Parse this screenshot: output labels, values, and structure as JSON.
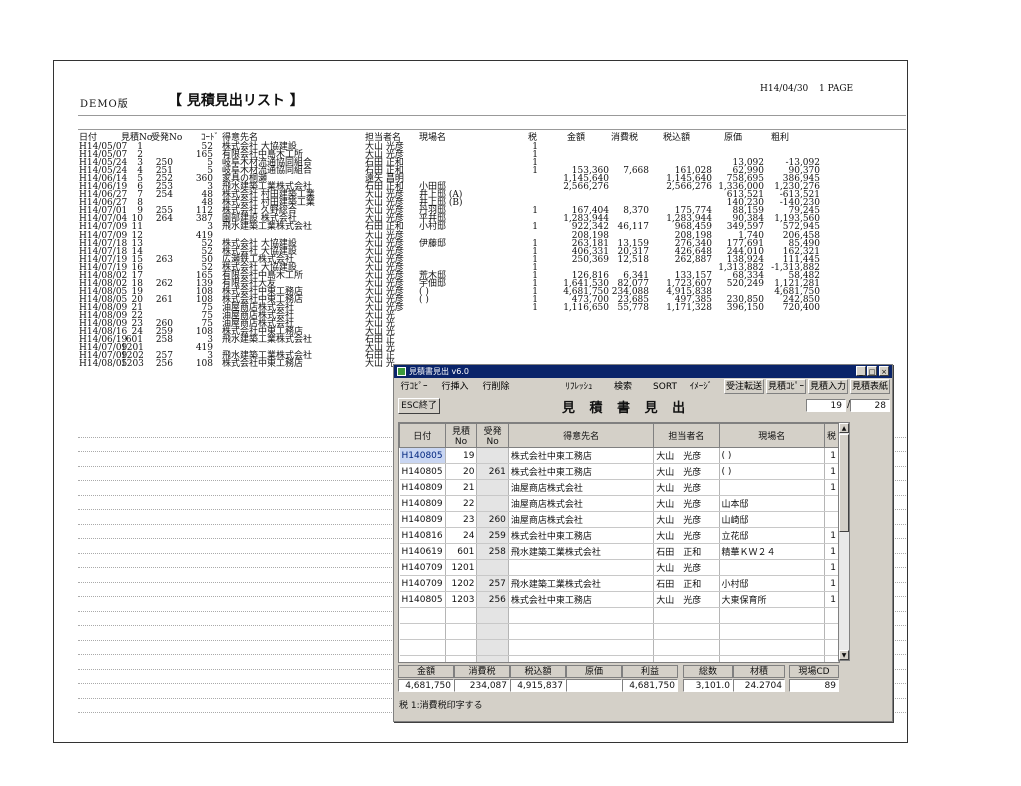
{
  "report": {
    "demo_label": "DEMO版",
    "title": "【 見積見出リスト 】",
    "date": "H14/04/30",
    "page": "1 PAGE",
    "headers": {
      "date": "日付",
      "mitsumori": "見積No",
      "juchu": "受発No",
      "code": "ｺｰﾄﾞ",
      "customer": "得意先名",
      "tanto": "担当者名",
      "genba": "現場名",
      "tax": "税",
      "amount": "金額",
      "shohizei": "消費税",
      "zeikomi": "税込額",
      "genka": "原価",
      "arari": "粗利"
    },
    "rows": [
      {
        "date": "H14/05/07",
        "no": "1",
        "juchu": "",
        "code": "52",
        "customer": "株式会社 大協建設",
        "tanto": "大山 光彦",
        "genba": "",
        "tax": "1",
        "amount": "",
        "shohizei": "",
        "zeikomi": "",
        "genka": "",
        "arari": ""
      },
      {
        "date": "H14/05/07",
        "no": "2",
        "juchu": "",
        "code": "165",
        "customer": "有限会社中島木工所",
        "tanto": "大山 光彦",
        "genba": "",
        "tax": "1",
        "amount": "",
        "shohizei": "",
        "zeikomi": "",
        "genka": "",
        "arari": ""
      },
      {
        "date": "H14/05/24",
        "no": "3",
        "juchu": "250",
        "code": "5",
        "customer": "岐阜木材流通協同組合",
        "tanto": "石田 正和",
        "genba": "",
        "tax": "1",
        "amount": "",
        "shohizei": "",
        "zeikomi": "",
        "genka": "13,092",
        "arari": "-13,092"
      },
      {
        "date": "H14/05/24",
        "no": "4",
        "juchu": "251",
        "code": "5",
        "customer": "岐阜木材流通協同組合",
        "tanto": "石田 正和",
        "genba": "",
        "tax": "1",
        "amount": "153,360",
        "shohizei": "7,668",
        "zeikomi": "161,028",
        "genka": "62,990",
        "arari": "90,370"
      },
      {
        "date": "H14/06/14",
        "no": "5",
        "juchu": "252",
        "code": "360",
        "customer": "家具の桐瀬",
        "tanto": "遠矢 昌明",
        "genba": "",
        "tax": "",
        "amount": "1,145,640",
        "shohizei": "",
        "zeikomi": "1,145,640",
        "genka": "758,695",
        "arari": "386,945"
      },
      {
        "date": "H14/06/19",
        "no": "6",
        "juchu": "253",
        "code": "3",
        "customer": "飛水建築工業株式会社",
        "tanto": "石田 正和",
        "genba": "小田邸",
        "tax": "",
        "amount": "2,566,276",
        "shohizei": "",
        "zeikomi": "2,566,276",
        "genka": "1,336,000",
        "arari": "1,230,276"
      },
      {
        "date": "H14/06/27",
        "no": "7",
        "juchu": "254",
        "code": "48",
        "customer": "株式会社 村田建築工業",
        "tanto": "大山 光彦",
        "genba": "井上邸 (A)",
        "tax": "",
        "amount": "",
        "shohizei": "",
        "zeikomi": "",
        "genka": "613,521",
        "arari": "-613,521"
      },
      {
        "date": "H14/06/27",
        "no": "8",
        "juchu": "",
        "code": "48",
        "customer": "株式会社 村田建築工業",
        "tanto": "大山 光彦",
        "genba": "井上邸 (B)",
        "tax": "",
        "amount": "",
        "shohizei": "",
        "zeikomi": "",
        "genka": "140,230",
        "arari": "-140,230"
      },
      {
        "date": "H14/07/01",
        "no": "9",
        "juchu": "255",
        "code": "112",
        "customer": "株式会社 久野総合",
        "tanto": "大山 光彦",
        "genba": "丹羽邸",
        "tax": "1",
        "amount": "167,404",
        "shohizei": "8,370",
        "zeikomi": "175,774",
        "genka": "88,159",
        "arari": "79,245"
      },
      {
        "date": "H14/07/04",
        "no": "10",
        "juchu": "264",
        "code": "387",
        "customer": "園部建設 株式会社",
        "tanto": "大山 光彦",
        "genba": "平井邸",
        "tax": "",
        "amount": "1,283,944",
        "shohizei": "",
        "zeikomi": "1,283,944",
        "genka": "90,384",
        "arari": "1,193,560"
      },
      {
        "date": "H14/07/09",
        "no": "11",
        "juchu": "",
        "code": "3",
        "customer": "飛水建築工業株式会社",
        "tanto": "石田 正和",
        "genba": "小村邸",
        "tax": "1",
        "amount": "922,342",
        "shohizei": "46,117",
        "zeikomi": "968,459",
        "genka": "349,597",
        "arari": "572,945"
      },
      {
        "date": "H14/07/09",
        "no": "12",
        "juchu": "",
        "code": "419",
        "customer": "",
        "tanto": "大山 光彦",
        "genba": "",
        "tax": "",
        "amount": "208,198",
        "shohizei": "",
        "zeikomi": "208,198",
        "genka": "1,740",
        "arari": "206,458"
      },
      {
        "date": "H14/07/18",
        "no": "13",
        "juchu": "",
        "code": "52",
        "customer": "株式会社 大協建設",
        "tanto": "大山 光彦",
        "genba": "伊藤邸",
        "tax": "1",
        "amount": "263,181",
        "shohizei": "13,159",
        "zeikomi": "276,340",
        "genka": "177,691",
        "arari": "85,490"
      },
      {
        "date": "H14/07/18",
        "no": "14",
        "juchu": "",
        "code": "52",
        "customer": "株式会社 大協建設",
        "tanto": "大山 光彦",
        "genba": "",
        "tax": "1",
        "amount": "406,331",
        "shohizei": "20,317",
        "zeikomi": "426,648",
        "genka": "244,010",
        "arari": "162,321"
      },
      {
        "date": "H14/07/19",
        "no": "15",
        "juchu": "263",
        "code": "50",
        "customer": "広瀬鉄工株式会社",
        "tanto": "大山 光彦",
        "genba": "",
        "tax": "1",
        "amount": "250,369",
        "shohizei": "12,518",
        "zeikomi": "262,887",
        "genka": "138,924",
        "arari": "111,445"
      },
      {
        "date": "H14/07/19",
        "no": "16",
        "juchu": "",
        "code": "52",
        "customer": "株式会社 大協建設",
        "tanto": "大山 光彦",
        "genba": "",
        "tax": "1",
        "amount": "",
        "shohizei": "",
        "zeikomi": "",
        "genka": "1,313,882",
        "arari": "-1,313,882"
      },
      {
        "date": "H14/08/02",
        "no": "17",
        "juchu": "",
        "code": "165",
        "customer": "有限会社中島木工所",
        "tanto": "大山 光彦",
        "genba": "荒木邸",
        "tax": "1",
        "amount": "126,816",
        "shohizei": "6,341",
        "zeikomi": "133,157",
        "genka": "68,334",
        "arari": "58,482"
      },
      {
        "date": "H14/08/02",
        "no": "18",
        "juchu": "262",
        "code": "139",
        "customer": "有限会社大友",
        "tanto": "大山 光彦",
        "genba": "宇佃邸",
        "tax": "1",
        "amount": "1,641,530",
        "shohizei": "82,077",
        "zeikomi": "1,723,607",
        "genka": "520,249",
        "arari": "1,121,281"
      },
      {
        "date": "H14/08/05",
        "no": "19",
        "juchu": "",
        "code": "108",
        "customer": "株式会社中東工務店",
        "tanto": "大山 光彦",
        "genba": "(                    )",
        "tax": "1",
        "amount": "4,681,750",
        "shohizei": "234,088",
        "zeikomi": "4,915,838",
        "genka": "",
        "arari": "4,681,750"
      },
      {
        "date": "H14/08/05",
        "no": "20",
        "juchu": "261",
        "code": "108",
        "customer": "株式会社中東工務店",
        "tanto": "大山 光彦",
        "genba": "(                    )",
        "tax": "1",
        "amount": "473,700",
        "shohizei": "23,685",
        "zeikomi": "497,385",
        "genka": "230,850",
        "arari": "242,850"
      },
      {
        "date": "H14/08/09",
        "no": "21",
        "juchu": "",
        "code": "75",
        "customer": "油屋商店株式会社",
        "tanto": "大山 光彦",
        "genba": "",
        "tax": "1",
        "amount": "1,116,650",
        "shohizei": "55,778",
        "zeikomi": "1,171,328",
        "genka": "396,150",
        "arari": "720,400"
      },
      {
        "date": "H14/08/09",
        "no": "22",
        "juchu": "",
        "code": "75",
        "customer": "油屋商店株式会社",
        "tanto": "大山 光",
        "genba": "",
        "tax": "",
        "amount": "",
        "shohizei": "",
        "zeikomi": "",
        "genka": "",
        "arari": ""
      },
      {
        "date": "H14/08/09",
        "no": "23",
        "juchu": "260",
        "code": "75",
        "customer": "油屋商店株式会社",
        "tanto": "大山 光",
        "genba": "",
        "tax": "",
        "amount": "",
        "shohizei": "",
        "zeikomi": "",
        "genka": "",
        "arari": ""
      },
      {
        "date": "H14/08/16",
        "no": "24",
        "juchu": "259",
        "code": "108",
        "customer": "株式会社中東工務店",
        "tanto": "大山 光",
        "genba": "",
        "tax": "",
        "amount": "",
        "shohizei": "",
        "zeikomi": "",
        "genka": "",
        "arari": ""
      },
      {
        "date": "H14/06/19",
        "no": "601",
        "juchu": "258",
        "code": "3",
        "customer": "飛水建築工業株式会社",
        "tanto": "石田 正",
        "genba": "",
        "tax": "",
        "amount": "",
        "shohizei": "",
        "zeikomi": "",
        "genka": "",
        "arari": ""
      },
      {
        "date": "H14/07/09",
        "no": "1201",
        "juchu": "",
        "code": "419",
        "customer": "",
        "tanto": "大山 光",
        "genba": "",
        "tax": "",
        "amount": "",
        "shohizei": "",
        "zeikomi": "",
        "genka": "",
        "arari": ""
      },
      {
        "date": "H14/07/09",
        "no": "1202",
        "juchu": "257",
        "code": "3",
        "customer": "飛水建築工業株式会社",
        "tanto": "石田 正",
        "genba": "",
        "tax": "",
        "amount": "",
        "shohizei": "",
        "zeikomi": "",
        "genka": "",
        "arari": ""
      },
      {
        "date": "H14/08/05",
        "no": "1203",
        "juchu": "256",
        "code": "108",
        "customer": "株式会社中東工務店",
        "tanto": "大山 光",
        "genba": "",
        "tax": "",
        "amount": "",
        "shohizei": "",
        "zeikomi": "",
        "genka": "",
        "arari": ""
      }
    ]
  },
  "window": {
    "title": "見積書見出 v6.0",
    "toolbar": [
      "行ｺﾋﾟｰ",
      "行挿入",
      "行削除",
      "ﾘﾌﾚｯｼｭ",
      "検索",
      "SORT",
      "ｲﾒｰｼﾞ",
      "受注転送",
      "見積ｺﾋﾟｰ",
      "見積入力",
      "見積表紙"
    ],
    "esc_label": "ESC終了",
    "heading": "見 積 書 見 出",
    "count_current": "19",
    "count_total": "28",
    "grid_headers": [
      "日付",
      "見積No",
      "受発No",
      "得意先名",
      "担当者名",
      "現場名",
      "税"
    ],
    "grid_rows": [
      [
        "H140805",
        "19",
        "",
        "株式会社中東工務店",
        "大山　光彦",
        "(                          )",
        "1"
      ],
      [
        "H140805",
        "20",
        "261",
        "株式会社中東工務店",
        "大山　光彦",
        "(                          )",
        "1"
      ],
      [
        "H140809",
        "21",
        "",
        "油屋商店株式会社",
        "大山　光彦",
        "",
        "1"
      ],
      [
        "H140809",
        "22",
        "",
        "油屋商店株式会社",
        "大山　光彦",
        "山本邸",
        ""
      ],
      [
        "H140809",
        "23",
        "260",
        "油屋商店株式会社",
        "大山　光彦",
        "山崎邸",
        ""
      ],
      [
        "H140816",
        "24",
        "259",
        "株式会社中東工務店",
        "大山　光彦",
        "立花邸",
        "1"
      ],
      [
        "H140619",
        "601",
        "258",
        "飛水建築工業株式会社",
        "石田　正和",
        "精華ＫＷ２４",
        "1"
      ],
      [
        "H140709",
        "1201",
        "",
        "",
        "大山　光彦",
        "",
        "1"
      ],
      [
        "H140709",
        "1202",
        "257",
        "飛水建築工業株式会社",
        "石田　正和",
        "小村邸",
        "1"
      ],
      [
        "H140805",
        "1203",
        "256",
        "株式会社中東工務店",
        "大山　光彦",
        "大東保育所",
        "1"
      ]
    ],
    "summary_headers": [
      "金額",
      "消費税",
      "税込額",
      "原価",
      "利益",
      "総数",
      "材積",
      "現場CD"
    ],
    "summary_values": [
      "4,681,750",
      "234,087",
      "4,915,837",
      "",
      "4,681,750",
      "3,101.0",
      "24.2704",
      "89"
    ],
    "note": "税 1:消費税印字する"
  }
}
